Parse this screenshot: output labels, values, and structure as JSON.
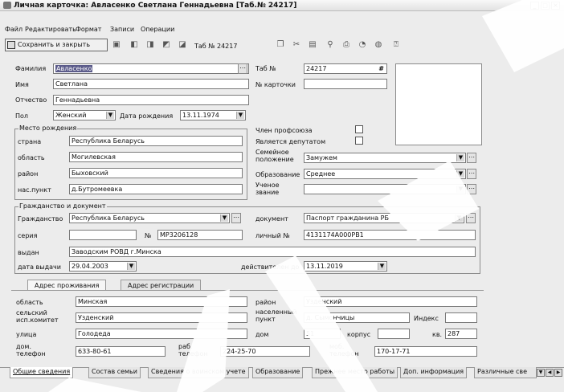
{
  "window": {
    "title": "Личная карточка: Авласенко Светлана Геннадьевна [Таб.№ 24217]"
  },
  "menu": [
    "Файл",
    "Редактировать",
    "Формат",
    "Записи",
    "Операции"
  ],
  "toolbar": {
    "save_close": "Сохранить и закрыть",
    "tab_label": "Таб №",
    "tab_value": "24217"
  },
  "person": {
    "surname_label": "Фамилия",
    "surname": "Авласенко",
    "name_label": "Имя",
    "name": "Светлана",
    "patronymic_label": "Отчество",
    "patronymic": "Геннадьевна",
    "sex_label": "Пол",
    "sex": "Женский",
    "birthdate_label": "Дата рождения",
    "birthdate": "13.11.1974",
    "tabno_label": "Таб №",
    "tabno": "24217",
    "hash": "#",
    "cardno_label": "№ карточки",
    "cardno": ""
  },
  "birthplace": {
    "title": "Место рождения",
    "country_label": "страна",
    "country": "Республика Беларусь",
    "region_label": "область",
    "region": "Могилевская",
    "district_label": "район",
    "district": "Быховский",
    "settlement_label": "нас.пункт",
    "settlement": "д.Бутромеевка"
  },
  "status": {
    "union_label": "Член профсоюза",
    "deputy_label": "Является депутатом",
    "marital_label": "Семейное положение",
    "marital": "Замужем",
    "education_label": "Образование",
    "education": "Среднее",
    "degree_label": "Ученое звание",
    "degree": ""
  },
  "citizenship": {
    "title": "Гражданство и документ",
    "country_label": "Гражданство",
    "country": "Республика Беларусь",
    "doc_label": "документ",
    "doc": "Паспорт гражданина РБ",
    "series_label": "серия",
    "series": "",
    "number_label": "№",
    "number": "МР3206128",
    "personal_label": "личный №",
    "personal": "4131174А000РВ1",
    "issued_label": "выдан",
    "issued": "Заводским РОВД г.Минска",
    "issue_date_label": "дата выдачи",
    "issue_date": "29.04.2003",
    "valid_label": "действителен до",
    "valid": "13.11.2019"
  },
  "address_tabs": [
    "Адрес проживания",
    "Адрес регистрации"
  ],
  "address": {
    "region_label": "область",
    "region": "Минская",
    "district_label": "район",
    "district": "Узденский",
    "council_label": "сельский исп.комитет",
    "council": "Узденский",
    "settlement_label": "населенный пункт",
    "settlement": "д. Сымончицы",
    "index_label": "Индекс",
    "index": "",
    "street_label": "улица",
    "street": "Голодеда",
    "house_label": "дом",
    "house": "51",
    "block_label": "корпус",
    "block": "",
    "flat_label": "кв.",
    "flat": "287",
    "home_phone_label": "дом. телефон",
    "home_phone": "633-80-61",
    "work_phone_label": "раб. телефон",
    "work_phone": "224-25-70",
    "mobile_label": "моб. телефон",
    "mobile": "170-17-71"
  },
  "bottom_tabs": [
    "Общие сведения",
    "Состав семьи",
    "Сведения о воинском учете",
    "Образование",
    "Прежнее место работы",
    "Доп. информация",
    "Различные све"
  ]
}
